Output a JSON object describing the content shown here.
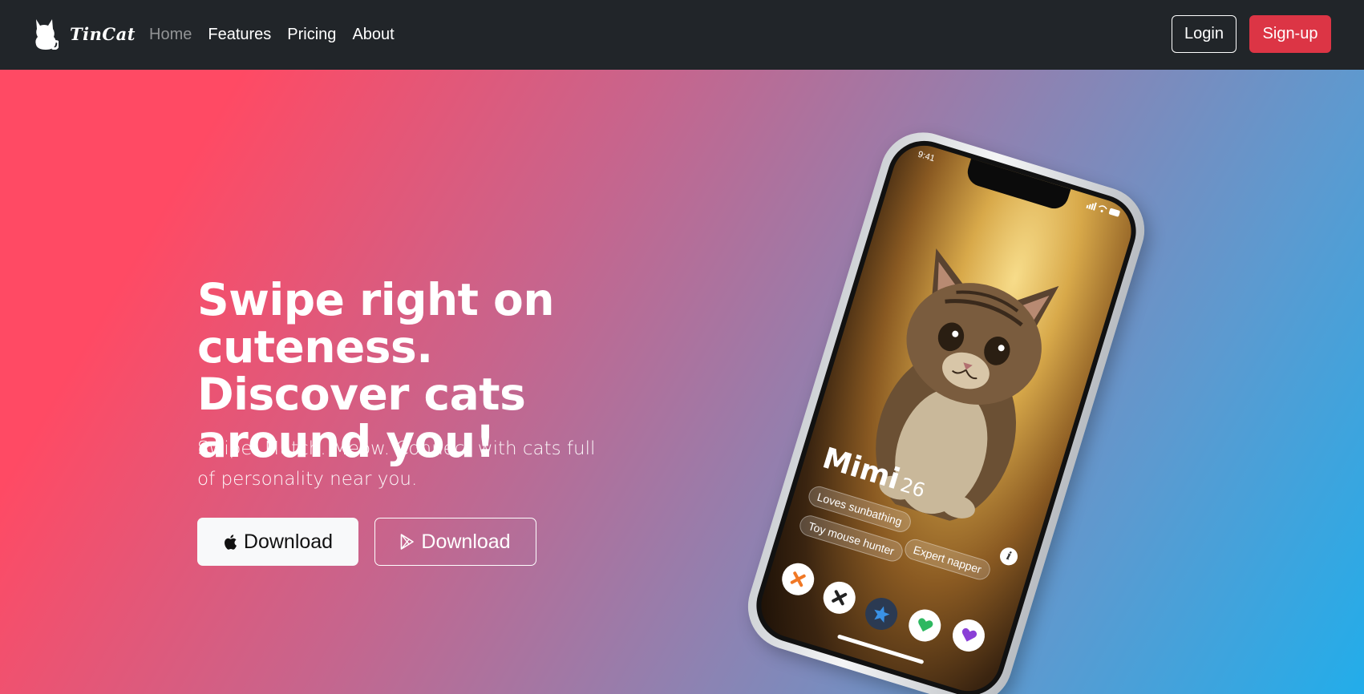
{
  "nav": {
    "brand": "TinCat",
    "links": [
      "Home",
      "Features",
      "Pricing",
      "About"
    ],
    "login_label": "Login",
    "signup_label": "Sign-up"
  },
  "hero": {
    "title": "Swipe right on cuteness. Discover cats around you!",
    "subtitle": "Swipe. Match. Meow. Connect with cats full of personality near you.",
    "apple_download_label": "Download",
    "play_download_label": "Download"
  },
  "phone": {
    "status_time": "9:41",
    "profile_name": "Mimi",
    "profile_age": "26",
    "tags": [
      "Loves sunbathing",
      "Expert napper",
      "Toy mouse hunter"
    ],
    "info_label": "i"
  },
  "colors": {
    "nav_bg": "#212529",
    "signup_red": "#dc3545",
    "gradient_start": "#ff4a64",
    "gradient_end": "#22adea"
  }
}
